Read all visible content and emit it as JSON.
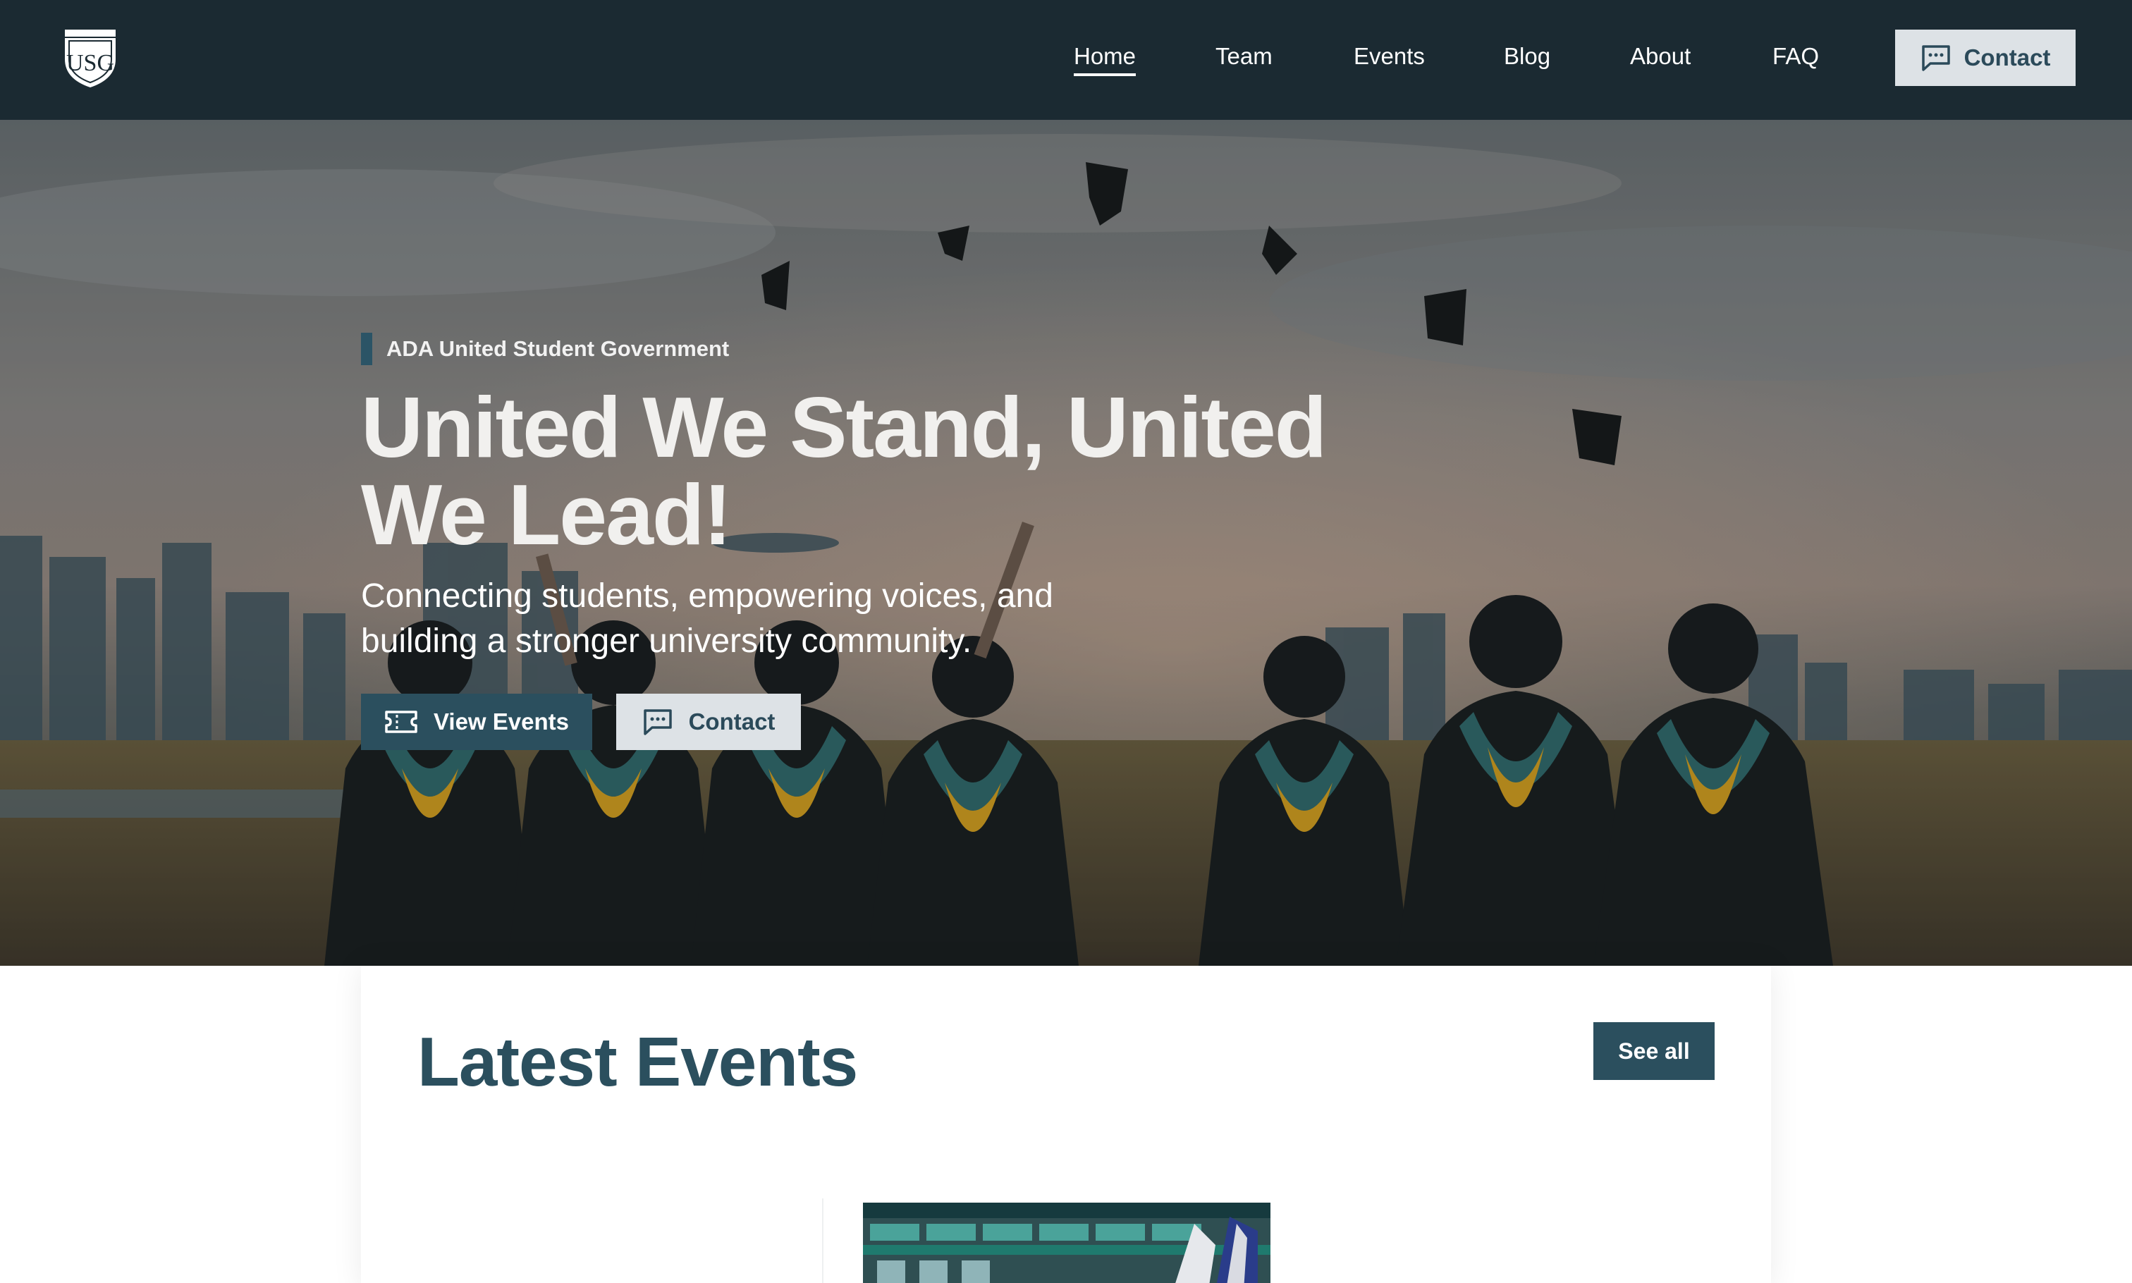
{
  "nav": {
    "logo_alt": "USG",
    "links": [
      "Home",
      "Team",
      "Events",
      "Blog",
      "About",
      "FAQ"
    ],
    "active": "Home",
    "contact_label": "Contact",
    "contact_icon": "message-square-icon"
  },
  "hero": {
    "eyebrow": "ADA United Student Government",
    "title_line1": "United We Stand, United",
    "title_line2": "We Lead!",
    "subtitle_line1": "Connecting students, empowering voices, and",
    "subtitle_line2": "building a stronger university community.",
    "primary_button": "View Events",
    "primary_icon": "ticket-icon",
    "secondary_button": "Contact",
    "secondary_icon": "message-square-icon"
  },
  "events": {
    "title": "Latest Events",
    "see_all": "See all"
  },
  "colors": {
    "navbar": "#1b2a32",
    "accent": "#2b4f5e",
    "light_button": "#dde2e6",
    "gown_gold": "#d9a21c",
    "gown_teal": "#2e6a6c"
  }
}
